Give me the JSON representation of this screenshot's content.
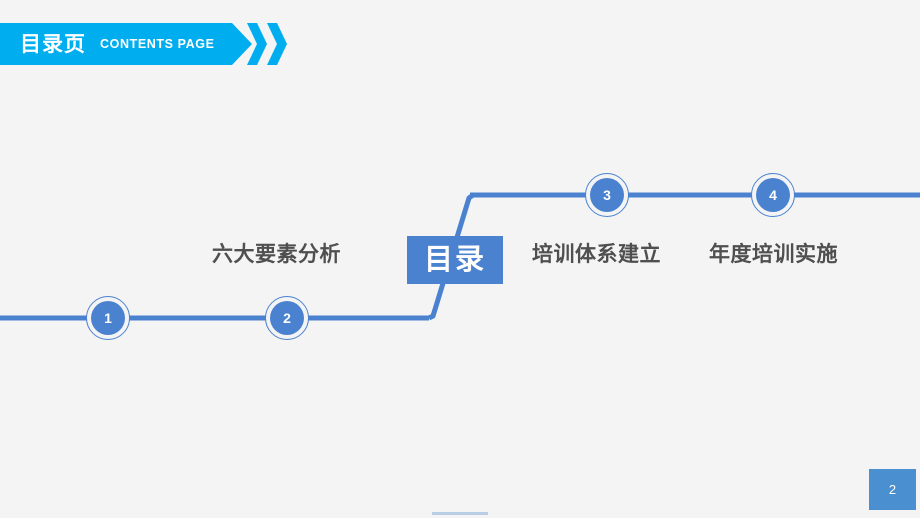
{
  "slide": {
    "background_color": "#f4f4f4"
  },
  "header": {
    "title_cn": "目录页",
    "title_en": "CONTENTS PAGE",
    "banner_color": "#00aeef",
    "chevron_icon_name": "double-chevron-right-icon"
  },
  "diagram": {
    "accent_color": "#4a82d0",
    "center_node": {
      "label": "目录"
    },
    "nodes": [
      {
        "number": "1",
        "label": ""
      },
      {
        "number": "2",
        "label": "六大要素分析"
      },
      {
        "number": "3",
        "label": "培训体系建立"
      },
      {
        "number": "4",
        "label": "年度培训实施"
      }
    ],
    "labels": {
      "item1": "六大要素分析",
      "item3": "培训体系建立",
      "item4": "年度培训实施"
    }
  },
  "footer": {
    "page_number": "2",
    "badge_color": "#4a90d0",
    "progress_color": "#b8cde4"
  }
}
